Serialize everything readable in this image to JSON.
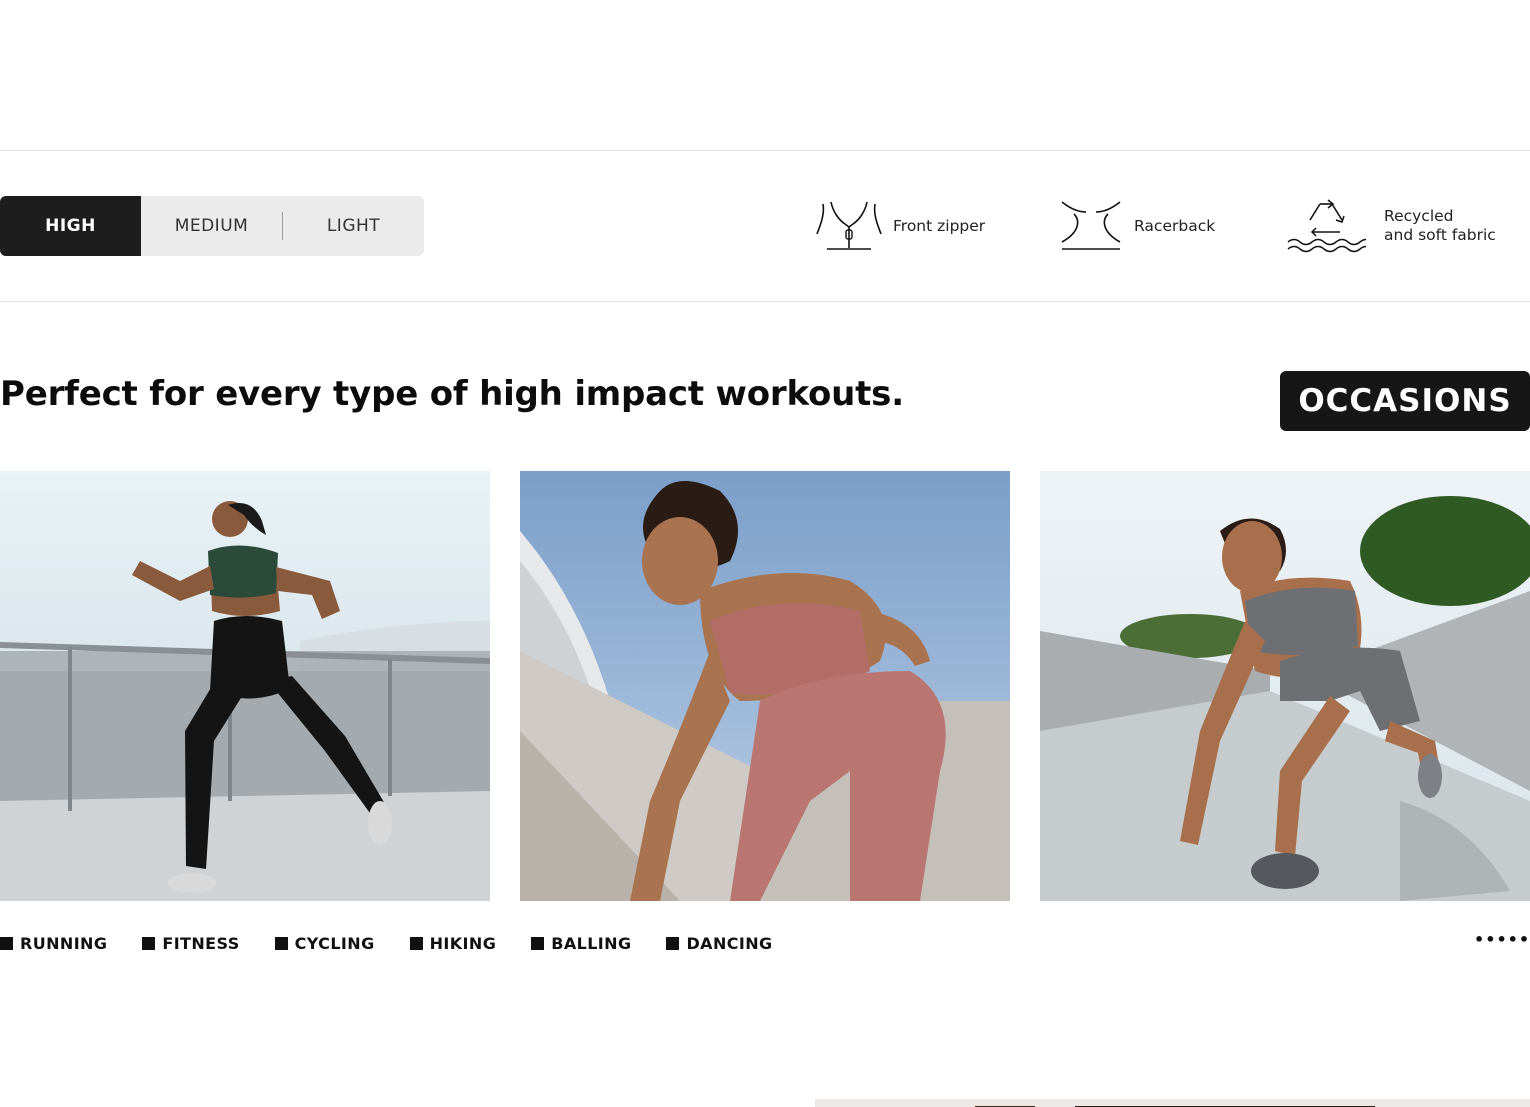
{
  "impact_levels": {
    "options": [
      {
        "label": "HIGH",
        "active": true
      },
      {
        "label": "MEDIUM",
        "active": false
      },
      {
        "label": "LIGHT",
        "active": false
      }
    ]
  },
  "features": [
    {
      "icon": "front-zipper-icon",
      "label": "Front zipper"
    },
    {
      "icon": "racerback-icon",
      "label": "Racerback"
    },
    {
      "icon": "recycle-icon",
      "label_line1": "Recycled",
      "label_line2": "and soft fabric"
    }
  ],
  "headline": "Perfect for every type of high impact workouts.",
  "section_badge": "OCCASIONS",
  "photos": [
    {
      "name": "running-woman-photo"
    },
    {
      "name": "stretching-woman-photo"
    },
    {
      "name": "lunging-woman-photo"
    }
  ],
  "activities": [
    "RUNNING",
    "FITNESS",
    "CYCLING",
    "HIKING",
    "BALLING",
    "DANCING"
  ],
  "more_indicator": "••••••"
}
